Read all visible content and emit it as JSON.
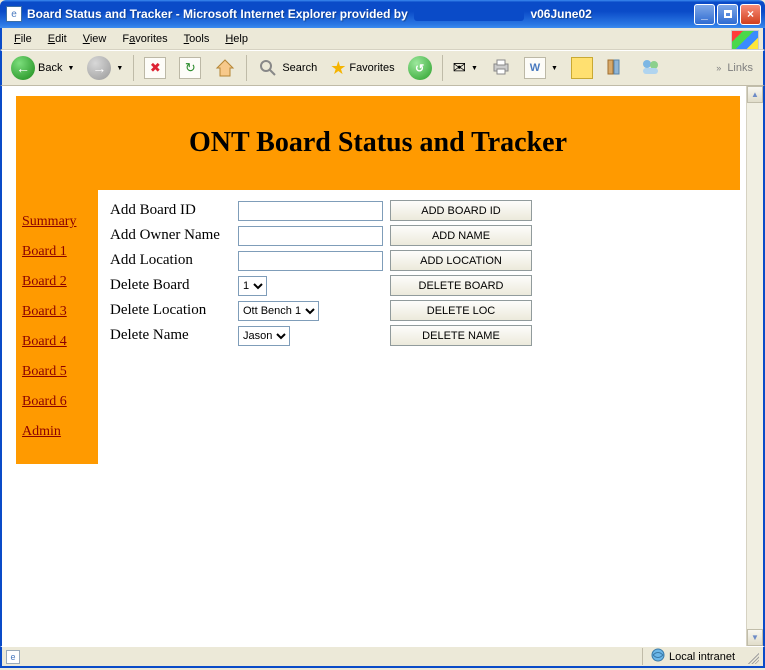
{
  "window": {
    "title_prefix": "Board Status and Tracker - Microsoft Internet Explorer provided by",
    "title_suffix": "v06June02"
  },
  "menus": {
    "file": "File",
    "edit": "Edit",
    "view": "View",
    "favorites": "Favorites",
    "tools": "Tools",
    "help": "Help"
  },
  "toolbar": {
    "back": "Back",
    "search": "Search",
    "favorites": "Favorites",
    "links": "Links"
  },
  "page": {
    "heading": "ONT Board Status and Tracker"
  },
  "sidebar": {
    "items": [
      {
        "label": "Summary"
      },
      {
        "label": "Board 1"
      },
      {
        "label": "Board 2"
      },
      {
        "label": "Board 3"
      },
      {
        "label": "Board 4"
      },
      {
        "label": "Board 5"
      },
      {
        "label": "Board 6"
      },
      {
        "label": "Admin"
      }
    ]
  },
  "form": {
    "rows": {
      "add_board_id": {
        "label": "Add Board ID",
        "button": "ADD BOARD ID"
      },
      "add_owner_name": {
        "label": "Add Owner Name",
        "button": "ADD NAME"
      },
      "add_location": {
        "label": "Add Location",
        "button": "ADD LOCATION"
      },
      "delete_board": {
        "label": "Delete Board",
        "button": "DELETE BOARD",
        "value": "1"
      },
      "delete_location": {
        "label": "Delete Location",
        "button": "DELETE LOC",
        "value": "Ott Bench 1"
      },
      "delete_name": {
        "label": "Delete Name",
        "button": "DELETE NAME",
        "value": "Jason"
      }
    }
  },
  "status": {
    "zone": "Local intranet"
  }
}
